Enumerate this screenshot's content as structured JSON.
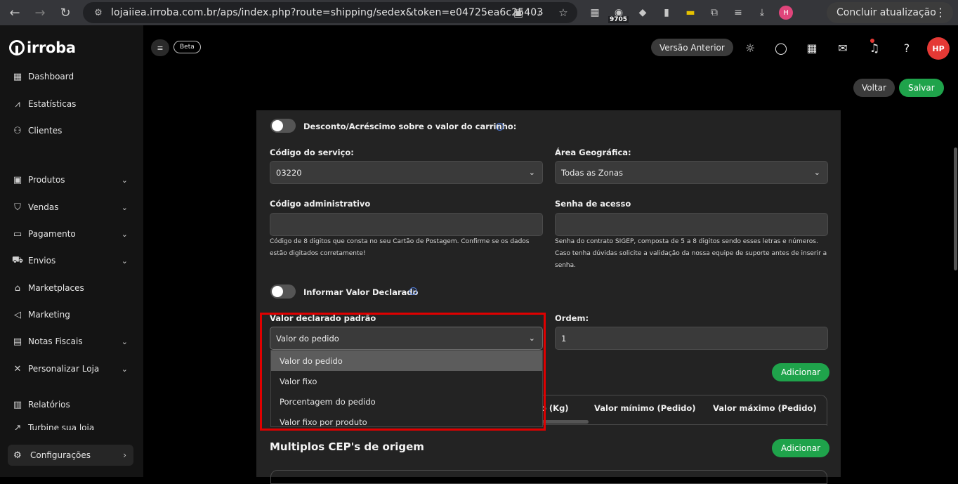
{
  "browser": {
    "url": "lojaiiea.irroba.com.br/aps/index.php?route=shipping/sedex&token=e04725ea6c25403",
    "extension_badge": "9705",
    "profile_initial": "H",
    "update_button": "Concluir atualização"
  },
  "sidebar": {
    "logo_text": "irroba",
    "items": [
      {
        "label": "Dashboard",
        "icon": "dashboard-icon"
      },
      {
        "label": "Estatísticas",
        "icon": "stats-icon"
      },
      {
        "label": "Clientes",
        "icon": "users-icon"
      },
      {
        "label": "Produtos",
        "icon": "box-icon"
      },
      {
        "label": "Vendas",
        "icon": "bag-icon"
      },
      {
        "label": "Pagamento",
        "icon": "card-icon"
      },
      {
        "label": "Envios",
        "icon": "truck-icon"
      },
      {
        "label": "Marketplaces",
        "icon": "store-icon"
      },
      {
        "label": "Marketing",
        "icon": "megaphone-icon"
      },
      {
        "label": "Notas Fiscais",
        "icon": "invoice-icon"
      },
      {
        "label": "Personalizar Loja",
        "icon": "tools-icon"
      },
      {
        "label": "Relatórios",
        "icon": "report-icon"
      },
      {
        "label": "Turbine sua loja",
        "icon": "rocket-icon"
      }
    ],
    "config_label": "Configurações"
  },
  "topbar": {
    "beta_label": "Beta",
    "previous_version": "Versão Anterior",
    "avatar_initials": "HP"
  },
  "actions": {
    "back": "Voltar",
    "save": "Salvar"
  },
  "form": {
    "discount_toggle_label": "Desconto/Acréscimo sobre o valor do carrinho:",
    "service_code_label": "Código do serviço:",
    "service_code_value": "03220",
    "geo_area_label": "Área Geográfica:",
    "geo_area_value": "Todas as Zonas",
    "admin_code_label": "Código administrativo",
    "admin_code_help": "Código de 8 digitos que consta no seu Cartão de Postagem. Confirme se os dados estão digitados corretamente!",
    "password_label": "Senha de acesso",
    "password_help": "Senha do contrato SIGEP, composta de 5 a 8 digitos sendo esses letras e números. Caso tenha dúvidas solicite a validação da nossa equipe de suporte antes de inserir a senha.",
    "declared_toggle_label": "Informar Valor Declarado",
    "declared_default_label": "Valor declarado padrão",
    "declared_default_value": "Valor do pedido",
    "order_label": "Ordem:",
    "order_value": "1",
    "add_button": "Adicionar"
  },
  "dropdown": {
    "options": [
      "Valor do pedido",
      "Valor fixo",
      "Porcentagem do pedido",
      "Valor fixo por produto"
    ],
    "selected": "Valor do pedido"
  },
  "table": {
    "columns": [
      "o (Kg)",
      "Valor mínimo (Pedido)",
      "Valor máximo (Pedido)"
    ]
  },
  "origin": {
    "title": "Multiplos CEP's de origem",
    "add_button": "Adicionar"
  }
}
